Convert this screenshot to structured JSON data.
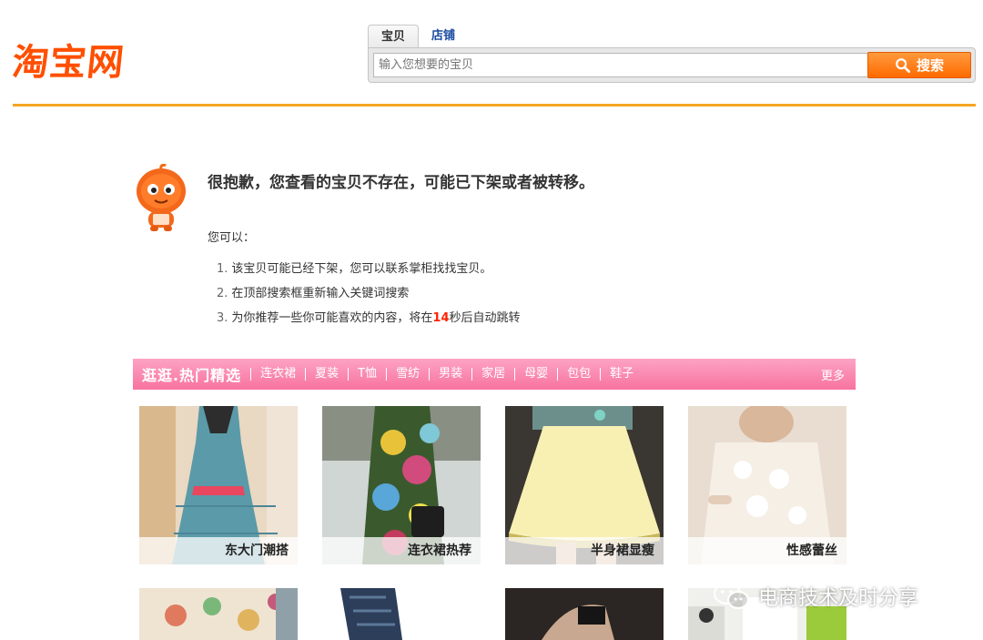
{
  "header": {
    "logo_text": "淘宝网",
    "search": {
      "tabs": [
        {
          "label": "宝贝",
          "active": true
        },
        {
          "label": "店铺",
          "active": false
        }
      ],
      "placeholder": "输入您想要的宝贝",
      "button_label": "搜索"
    }
  },
  "message": {
    "title": "很抱歉，您查看的宝贝不存在，可能已下架或者被转移。",
    "subtitle": "您可以：",
    "items": [
      {
        "num": "1.",
        "text": "该宝贝可能已经下架，您可以联系掌柜找找宝贝。"
      },
      {
        "num": "2.",
        "text": "在顶部搜索框重新输入关键词搜索"
      },
      {
        "num": "3.",
        "text_before": "为你推荐一些你可能喜欢的内容，将在",
        "countdown": "14",
        "text_after": "秒后自动跳转"
      }
    ]
  },
  "category_bar": {
    "title": "逛逛.热门精选",
    "items": [
      "连衣裙",
      "夏装",
      "T恤",
      "雪纺",
      "男装",
      "家居",
      "母婴",
      "包包",
      "鞋子"
    ],
    "more": "更多"
  },
  "products": [
    {
      "caption": "东大门潮搭"
    },
    {
      "caption": "连衣裙热荐"
    },
    {
      "caption": "半身裙显瘦"
    },
    {
      "caption": "性感蕾丝"
    }
  ],
  "watermark": {
    "text": "电商技术及时分享"
  },
  "colors": {
    "accent": "#ff6a00",
    "brand": "#ff4f00",
    "divider": "#f5a623",
    "pink_bar": "#f7739f",
    "countdown": "#ff2200"
  }
}
